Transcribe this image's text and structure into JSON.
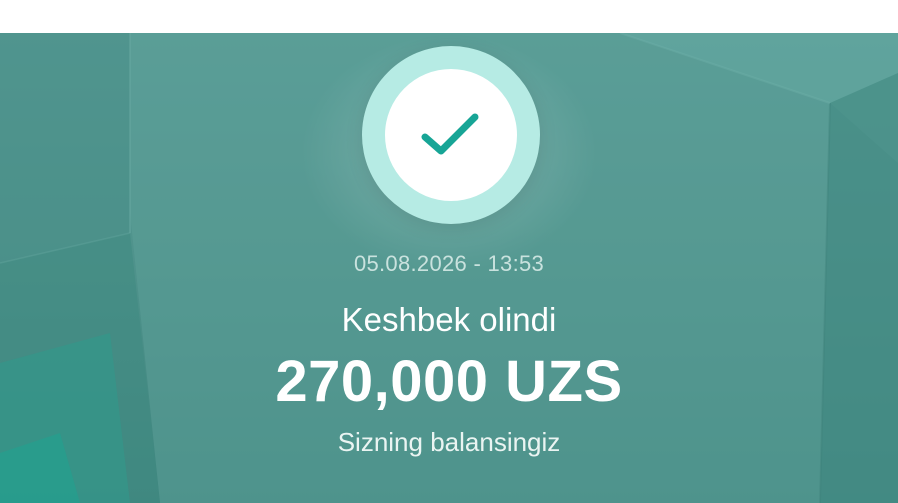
{
  "notification": {
    "datetime": "05.08.2026 - 13:53",
    "title": "Keshbek olindi",
    "amount": "270,000 UZS",
    "subtitle": "Sizning balansingiz"
  },
  "icons": {
    "status": "check-icon"
  },
  "colors": {
    "panel_background": "#4f938c",
    "badge_ring": "#b6ebe4",
    "checkmark": "#17a596",
    "text_primary": "#ffffff",
    "text_secondary": "#c9e2de"
  }
}
